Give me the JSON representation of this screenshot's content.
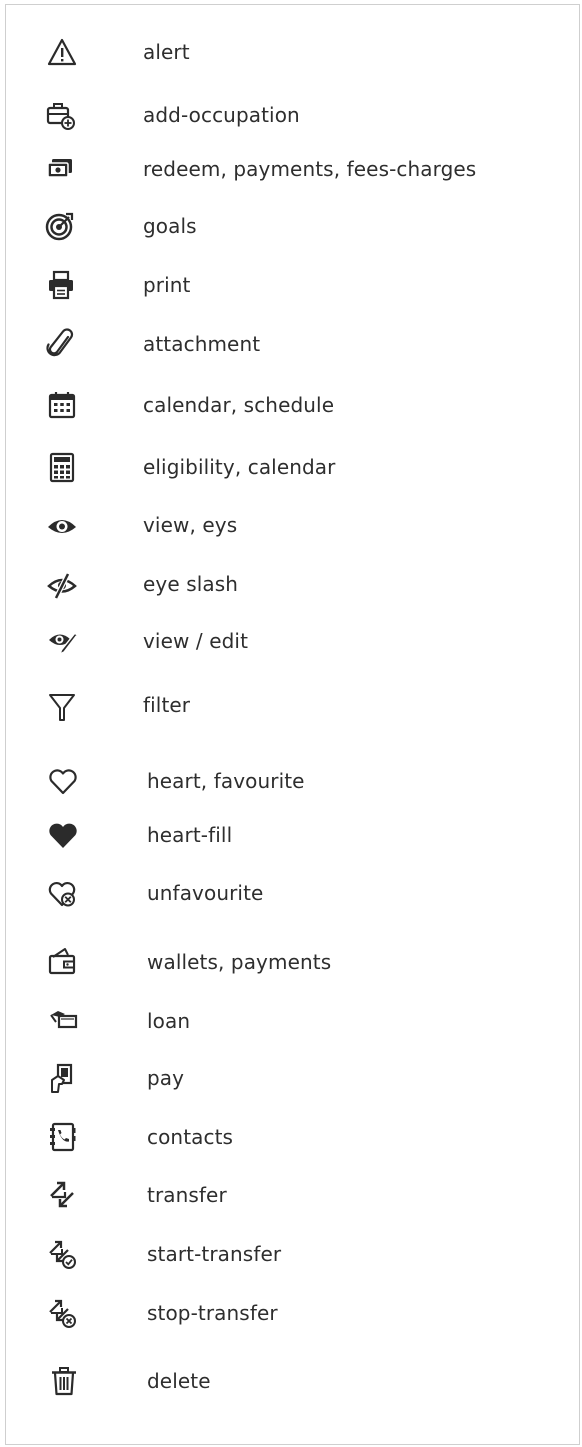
{
  "icons": [
    {
      "name": "alert-icon",
      "label": "alert"
    },
    {
      "name": "add-occupation-icon",
      "label": "add-occupation"
    },
    {
      "name": "redeem-icon",
      "label": "redeem, payments, fees-charges"
    },
    {
      "name": "goals-icon",
      "label": "goals"
    },
    {
      "name": "print-icon",
      "label": "print"
    },
    {
      "name": "attachment-icon",
      "label": "attachment"
    },
    {
      "name": "calendar-icon",
      "label": "calendar, schedule"
    },
    {
      "name": "calculator-icon",
      "label": "eligibility, calendar"
    },
    {
      "name": "eye-icon",
      "label": "view, eys"
    },
    {
      "name": "eye-slash-icon",
      "label": "eye slash"
    },
    {
      "name": "view-edit-icon",
      "label": "view / edit"
    },
    {
      "name": "filter-icon",
      "label": "filter"
    },
    {
      "name": "heart-icon",
      "label": "heart, favourite"
    },
    {
      "name": "heart-fill-icon",
      "label": "heart-fill"
    },
    {
      "name": "unfavourite-icon",
      "label": "unfavourite"
    },
    {
      "name": "wallet-icon",
      "label": "wallets, payments"
    },
    {
      "name": "loan-icon",
      "label": "loan"
    },
    {
      "name": "pay-icon",
      "label": "pay"
    },
    {
      "name": "contacts-icon",
      "label": "contacts"
    },
    {
      "name": "transfer-icon",
      "label": "transfer"
    },
    {
      "name": "start-transfer-icon",
      "label": "start-transfer"
    },
    {
      "name": "stop-transfer-icon",
      "label": "stop-transfer"
    },
    {
      "name": "delete-icon",
      "label": "delete"
    }
  ],
  "colors": {
    "icon": "#2b2b2b",
    "text": "#2e2e2e",
    "border": "#cfcfcf"
  }
}
